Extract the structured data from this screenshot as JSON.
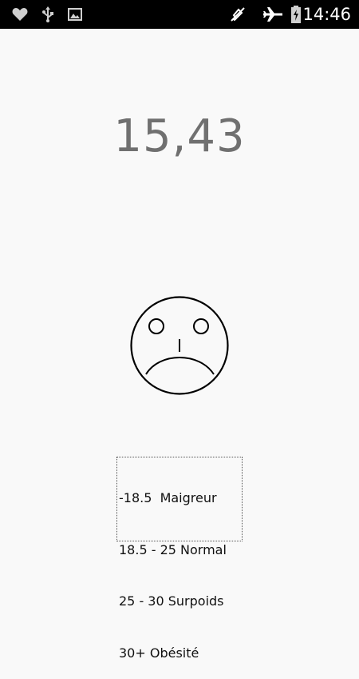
{
  "status_bar": {
    "time": "14:46",
    "icons_left": [
      "heart-icon",
      "usb-icon",
      "image-icon"
    ],
    "icons_right": [
      "mute-icon",
      "airplane-mode-icon",
      "battery-charging-icon"
    ]
  },
  "bmi": {
    "value": "15,43"
  },
  "face": {
    "mood": "sad-face-icon"
  },
  "legend": {
    "lines": [
      "-18.5  Maigreur",
      "18.5 - 25 Normal",
      "25 - 30 Surpoids",
      "30+ Obésité"
    ]
  }
}
